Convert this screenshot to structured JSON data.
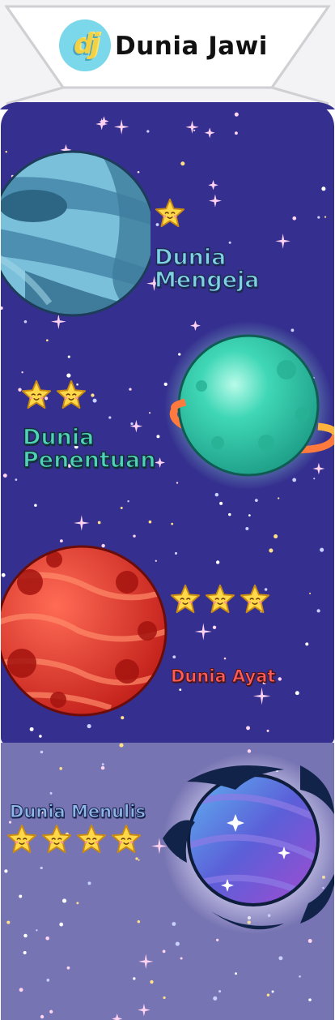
{
  "header": {
    "logo_text": "dj",
    "title": "Dunia Jawi"
  },
  "worlds": [
    {
      "name": "Dunia Mengeja",
      "line1": "Dunia",
      "line2": "Mengeja",
      "stars": 1,
      "label_color": "#7fd2e3",
      "planet_color": "#5a9ec0"
    },
    {
      "name": "Dunia Penentuan",
      "line1": "Dunia",
      "line2": "Penentuan",
      "stars": 2,
      "label_color": "#4fd2b8",
      "planet_color": "#2fc7a8"
    },
    {
      "name": "Dunia Ayat",
      "stars": 3,
      "label_color": "#ff5b5b",
      "planet_color": "#e03128"
    },
    {
      "name": "Dunia Menulis",
      "stars": 4,
      "label_color": "#8fb6e8",
      "planet_color": "#5b6fd8"
    }
  ],
  "colors": {
    "space_background": "#35308f",
    "locked_background": "#7774b3",
    "star_fill": "#ffd84a"
  },
  "icons": {
    "star": "smiling-star-icon",
    "logo": "dj-logo-icon"
  }
}
